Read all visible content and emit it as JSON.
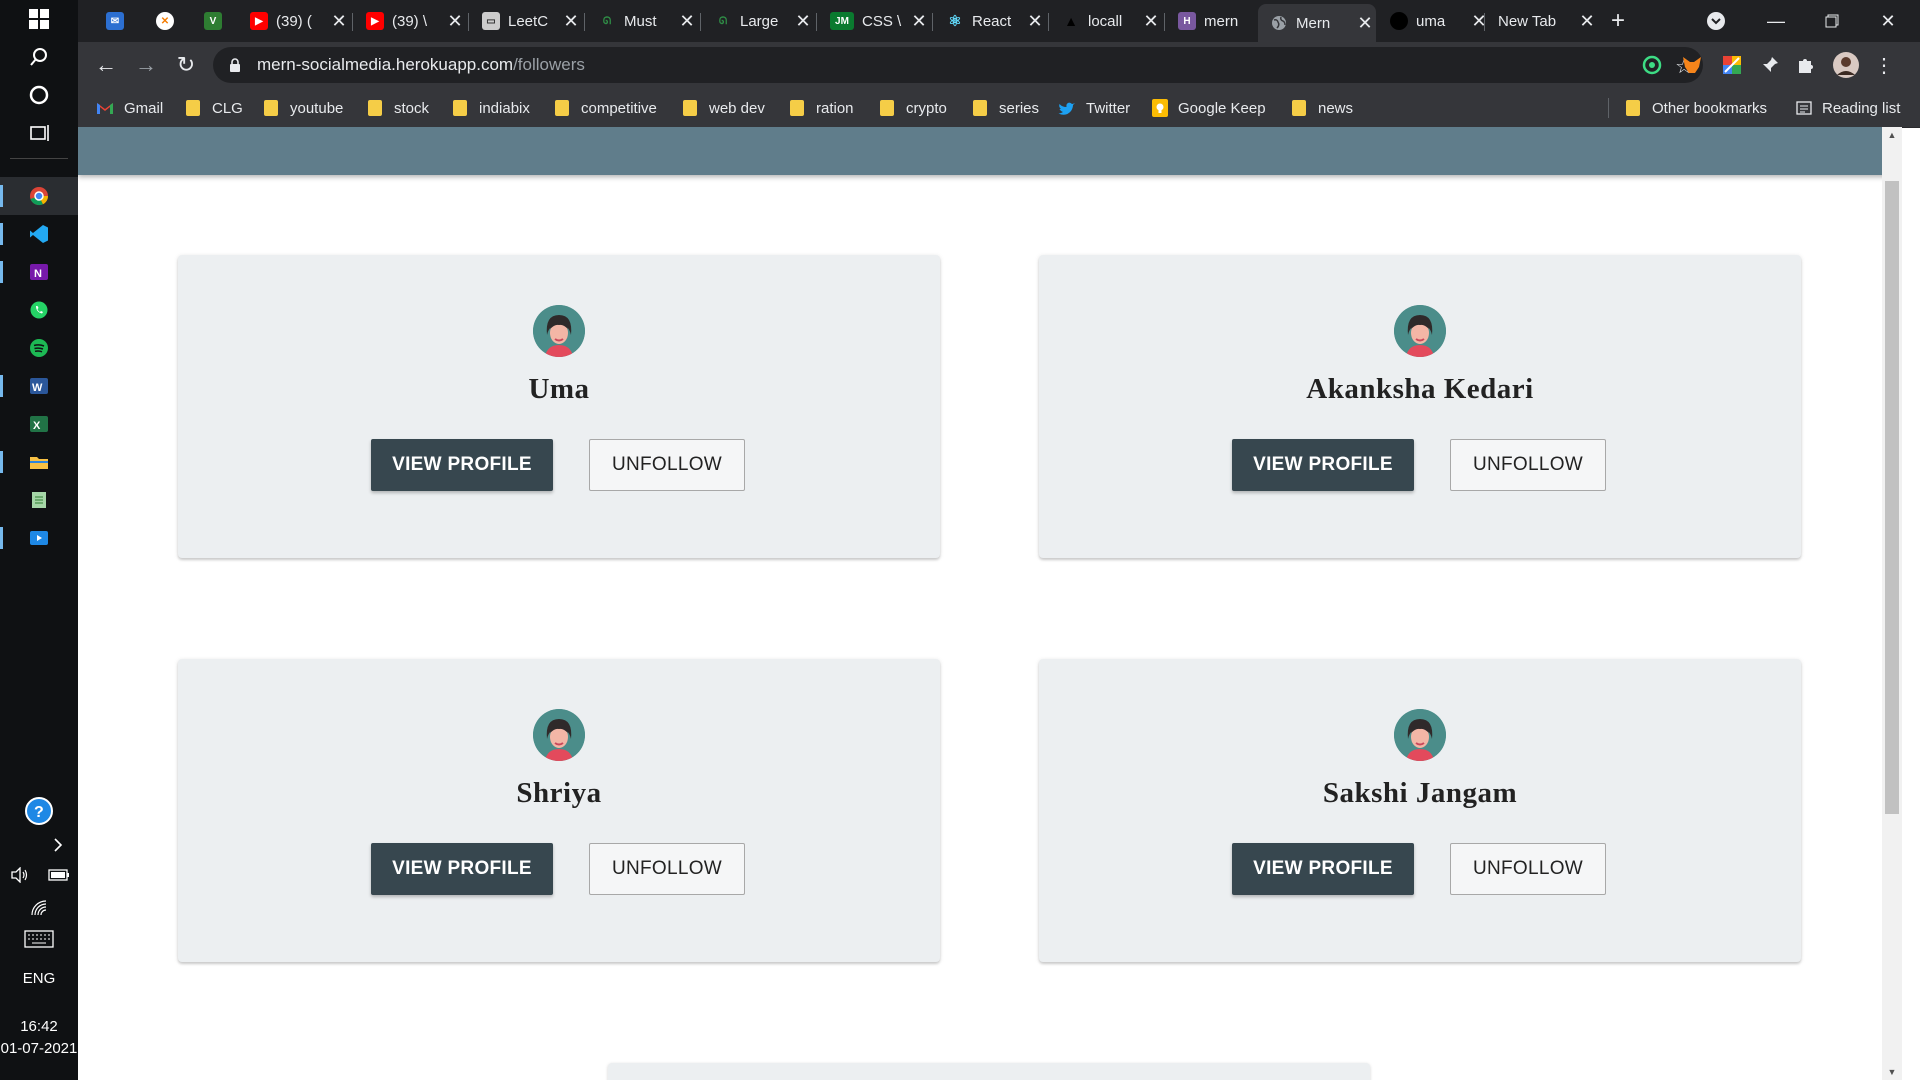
{
  "taskbar": {
    "language": "ENG",
    "time": "16:42",
    "date": "01-07-2021"
  },
  "tabs": [
    {
      "title": "",
      "icon": "mail-icon",
      "color": "#2c6fd1"
    },
    {
      "title": "",
      "icon": "orange-x-icon",
      "color": "#f57c00"
    },
    {
      "title": "",
      "icon": "green-v-icon",
      "color": "#2e7d32"
    },
    {
      "title": "(39) (",
      "icon": "youtube-icon",
      "color": "#ff0000"
    },
    {
      "title": "(39) \\",
      "icon": "youtube-icon",
      "color": "#ff0000"
    },
    {
      "title": "LeetC",
      "icon": "leetcode-icon",
      "color": "#cccccc"
    },
    {
      "title": "Must",
      "icon": "geeksforgeeks-icon",
      "color": "#2f8d46"
    },
    {
      "title": "Large",
      "icon": "geeksforgeeks-icon",
      "color": "#2f8d46"
    },
    {
      "title": "CSS \\",
      "icon": "jm-icon",
      "color": "#0a7a2f"
    },
    {
      "title": "React",
      "icon": "react-icon",
      "color": "#61dafb"
    },
    {
      "title": "locall",
      "icon": "vercel-icon",
      "color": "#000000"
    },
    {
      "title": "mern",
      "icon": "heroku-icon",
      "color": "#79589f"
    },
    {
      "title": "Mern",
      "icon": "globe-icon",
      "color": "#9aa0a6"
    },
    {
      "title": "uma",
      "icon": "github-icon",
      "color": "#000000"
    },
    {
      "title": "New Tab",
      "icon": "",
      "color": ""
    }
  ],
  "address": {
    "domain": "mern-socialmedia.herokuapp.com",
    "path": "/followers"
  },
  "bookmarks": [
    {
      "label": "Gmail",
      "type": "gmail"
    },
    {
      "label": "CLG",
      "type": "folder"
    },
    {
      "label": "youtube",
      "type": "folder"
    },
    {
      "label": "stock",
      "type": "folder"
    },
    {
      "label": "indiabix",
      "type": "folder"
    },
    {
      "label": "competitive",
      "type": "folder"
    },
    {
      "label": "web dev",
      "type": "folder"
    },
    {
      "label": "ration",
      "type": "folder"
    },
    {
      "label": "crypto",
      "type": "folder"
    },
    {
      "label": "series",
      "type": "folder"
    },
    {
      "label": "Twitter",
      "type": "twitter"
    },
    {
      "label": "Google Keep",
      "type": "keep"
    },
    {
      "label": "news",
      "type": "folder"
    }
  ],
  "other_bookmarks": "Other bookmarks",
  "reading_list": "Reading list",
  "followers": [
    {
      "name": "Uma",
      "view_label": "VIEW PROFILE",
      "unfollow_label": "UNFOLLOW"
    },
    {
      "name": "Akanksha Kedari",
      "view_label": "VIEW PROFILE",
      "unfollow_label": "UNFOLLOW"
    },
    {
      "name": "Shriya",
      "view_label": "VIEW PROFILE",
      "unfollow_label": "UNFOLLOW"
    },
    {
      "name": "Sakshi Jangam",
      "view_label": "VIEW PROFILE",
      "unfollow_label": "UNFOLLOW"
    }
  ],
  "colors": {
    "navbar": "#607d8b",
    "card_bg": "#eceff1",
    "view_button": "#37474f"
  }
}
